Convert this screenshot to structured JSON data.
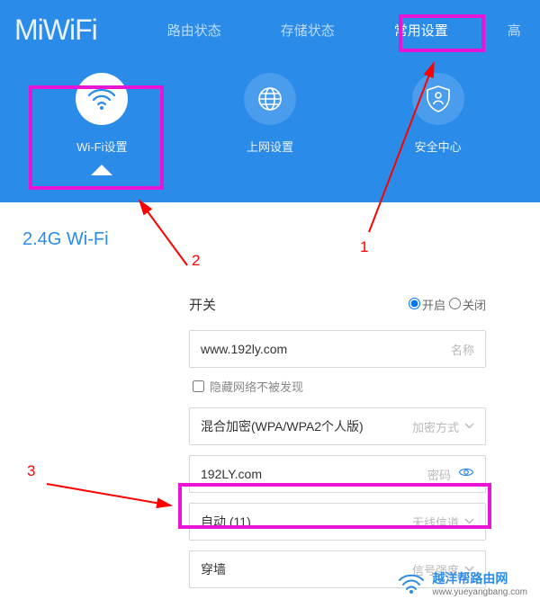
{
  "header": {
    "logo": "MiWiFi",
    "nav": {
      "status": "路由状态",
      "storage": "存储状态",
      "settings": "常用设置",
      "advanced": "高"
    }
  },
  "tabs": {
    "wifi": "Wi-Fi设置",
    "internet": "上网设置",
    "security": "安全中心"
  },
  "section": {
    "title": "2.4G Wi-Fi"
  },
  "form": {
    "switch": {
      "label": "开关",
      "on": "开启",
      "off": "关闭"
    },
    "name": {
      "value": "www.192ly.com",
      "label": "名称"
    },
    "hide": {
      "label": "隐藏网络不被发现"
    },
    "encryption": {
      "value": "混合加密(WPA/WPA2个人版)",
      "label": "加密方式"
    },
    "password": {
      "value": "192LY.com",
      "label": "密码"
    },
    "channel": {
      "value": "自动 (11)",
      "label": "无线信道"
    },
    "strength": {
      "value": "穿墙",
      "label": "信号强度"
    }
  },
  "annotations": {
    "1": "1",
    "2": "2",
    "3": "3"
  },
  "watermark": {
    "cn": "越洋帮路由网",
    "en": "www.yueyangbang.com"
  }
}
